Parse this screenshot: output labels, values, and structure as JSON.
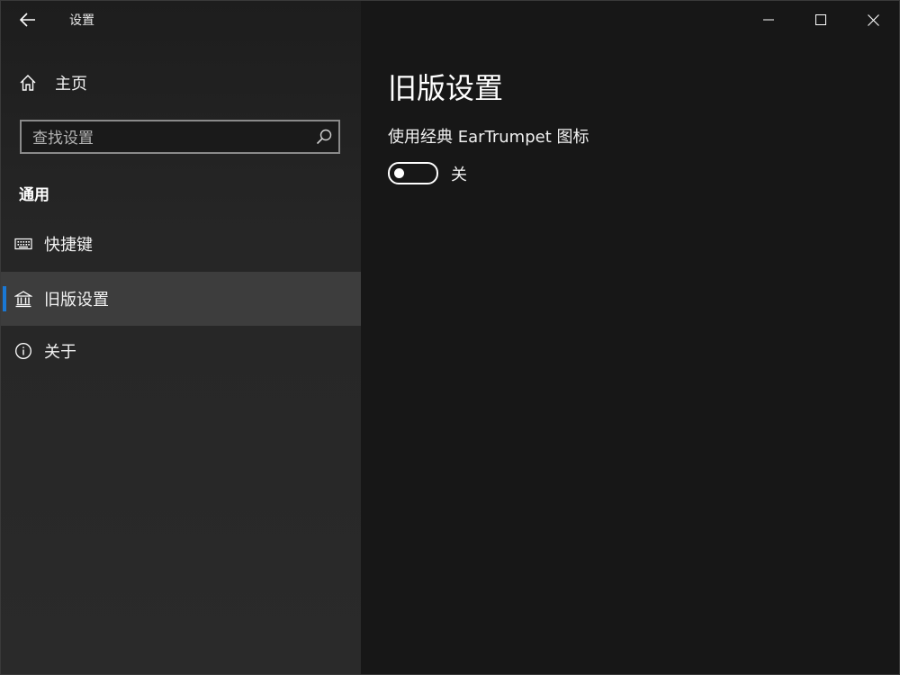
{
  "window": {
    "title": "设置"
  },
  "sidebar": {
    "home_label": "主页",
    "search": {
      "placeholder": "查找设置",
      "value": ""
    },
    "section_heading": "通用",
    "items": [
      {
        "label": "快捷键",
        "icon": "keyboard-icon",
        "selected": false
      },
      {
        "label": "旧版设置",
        "icon": "library-icon",
        "selected": true
      },
      {
        "label": "关于",
        "icon": "info-icon",
        "selected": false
      }
    ]
  },
  "main": {
    "page_title": "旧版设置",
    "setting": {
      "label": "使用经典 EarTrumpet 图标",
      "toggle_on": false,
      "state_text": "关"
    }
  },
  "colors": {
    "accent": "#1a78d4",
    "sidebar_bg": "#2a2a2a",
    "content_bg": "#171717",
    "selected_bg": "#3d3d3d"
  }
}
